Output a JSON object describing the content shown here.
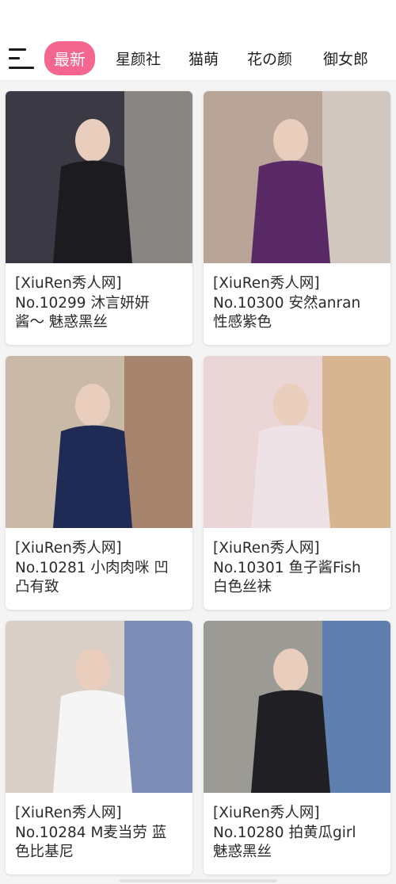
{
  "nav": {
    "tabs": [
      {
        "label": "最新",
        "active": true
      },
      {
        "label": "星颜社",
        "active": false
      },
      {
        "label": "猫萌",
        "active": false
      },
      {
        "label": "花の颜",
        "active": false
      },
      {
        "label": "御女郎",
        "active": false
      }
    ]
  },
  "cards": [
    {
      "line1": "[XiuRen秀人网]",
      "line2": "No.10299 沐言妍妍",
      "line3": "酱～ 魅惑黑丝",
      "palette": {
        "bg": "#3b3a44",
        "accent": "#c9c2b8",
        "figure": "#1c1b20"
      }
    },
    {
      "line1": "[XiuRen秀人网]",
      "line2": "No.10300 安然anran",
      "line3": "性感紫色",
      "palette": {
        "bg": "#b8a597",
        "accent": "#e8e3e0",
        "figure": "#5a2a66"
      }
    },
    {
      "line1": "[XiuRen秀人网]",
      "line2": "No.10281 小肉肉咪 凹",
      "line3": "凸有致",
      "palette": {
        "bg": "#c9b9a7",
        "accent": "#8a5a40",
        "figure": "#1f2a55"
      }
    },
    {
      "line1": "[XiuRen秀人网]",
      "line2": "No.10301 鱼子酱Fish",
      "line3": "白色丝袜",
      "palette": {
        "bg": "#ead6d6",
        "accent": "#c79a5a",
        "figure": "#efe2e6"
      }
    },
    {
      "line1": "[XiuRen秀人网]",
      "line2": "No.10284 M麦当劳 蓝",
      "line3": "色比基尼",
      "palette": {
        "bg": "#d9cfc6",
        "accent": "#2f5aa8",
        "figure": "#f5f5f5"
      }
    },
    {
      "line1": "[XiuRen秀人网]",
      "line2": "No.10280 拍黄瓜girl",
      "line3": "魅惑黑丝",
      "palette": {
        "bg": "#9c9a94",
        "accent": "#2d6cc4",
        "figure": "#202024"
      }
    }
  ]
}
